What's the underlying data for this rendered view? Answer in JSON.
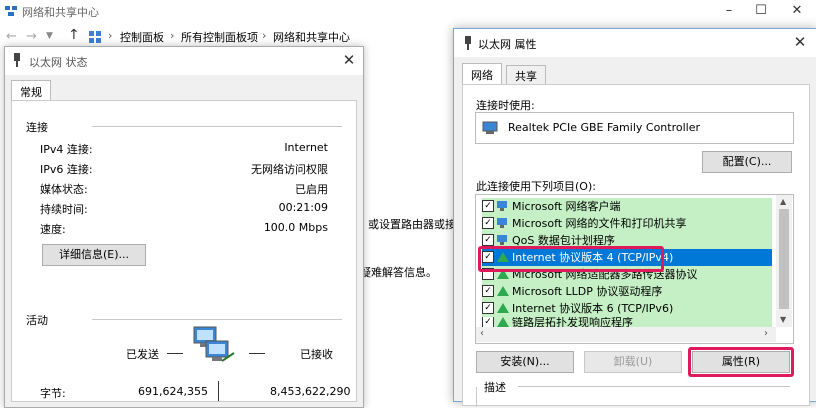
{
  "background_window": {
    "title": "网络和共享中心",
    "breadcrumbs": [
      "控制面板",
      "所有控制面板项",
      "网络和共享中心"
    ],
    "right_fragments": [
      "或设置路由器或接",
      "疑难解答信息。"
    ]
  },
  "status_dialog": {
    "title": "以太网 状态",
    "tab": "常规",
    "connection_section": "连接",
    "rows": [
      {
        "key": "IPv4 连接:",
        "value": "Internet"
      },
      {
        "key": "IPv6 连接:",
        "value": "无网络访问权限"
      },
      {
        "key": "媒体状态:",
        "value": "已启用"
      },
      {
        "key": "持续时间:",
        "value": "00:21:09"
      },
      {
        "key": "速度:",
        "value": "100.0 Mbps"
      }
    ],
    "details_button": "详细信息(E)...",
    "activity_section": "活动",
    "sent_label": "已发送",
    "received_label": "已接收",
    "bytes_label": "字节:",
    "bytes_sent": "691,624,355",
    "bytes_received": "8,453,622,290"
  },
  "properties_dialog": {
    "title": "以太网 属性",
    "tabs": [
      "网络",
      "共享"
    ],
    "connect_using_label": "连接时使用:",
    "adapter_name": "Realtek PCIe GBE Family Controller",
    "configure_button": "配置(C)...",
    "items_label": "此连接使用下列项目(O):",
    "items": [
      {
        "label": "Microsoft 网络客户端",
        "checked": true
      },
      {
        "label": "Microsoft 网络的文件和打印机共享",
        "checked": true
      },
      {
        "label": "QoS 数据包计划程序",
        "checked": true
      },
      {
        "label": "Internet 协议版本 4 (TCP/IPv4)",
        "checked": true
      },
      {
        "label": "Microsoft 网络适配器多路传送器协议",
        "checked": false
      },
      {
        "label": "Microsoft LLDP 协议驱动程序",
        "checked": true
      },
      {
        "label": "Internet 协议版本 6 (TCP/IPv6)",
        "checked": true
      },
      {
        "label": "链路层拓扑发现响应程序",
        "checked": true
      }
    ],
    "install_button": "安装(N)...",
    "uninstall_button": "卸载(U)",
    "properties_button": "属性(R)",
    "description_label": "描述"
  },
  "colors": {
    "highlight": "#e0195b",
    "selection": "#0078d7",
    "list_green": "#c5f0c5"
  }
}
